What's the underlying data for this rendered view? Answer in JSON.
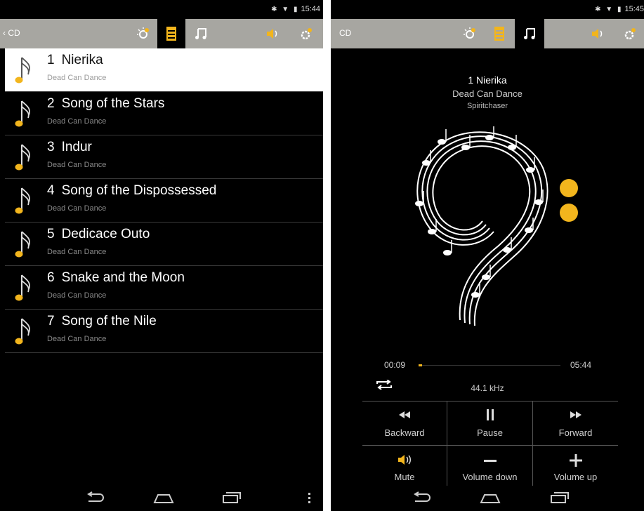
{
  "status": {
    "time_left": "15:44",
    "time_right": "15:45"
  },
  "left": {
    "back_label": "CD",
    "tracks": [
      {
        "num": "1",
        "title": "Nierika",
        "artist": "Dead Can Dance"
      },
      {
        "num": "2",
        "title": "Song of the Stars",
        "artist": "Dead Can Dance"
      },
      {
        "num": "3",
        "title": "Indur",
        "artist": "Dead Can Dance"
      },
      {
        "num": "4",
        "title": "Song of the Dispossessed",
        "artist": "Dead Can Dance"
      },
      {
        "num": "5",
        "title": "Dedicace Outo",
        "artist": "Dead Can Dance"
      },
      {
        "num": "6",
        "title": "Snake and the Moon",
        "artist": "Dead Can Dance"
      },
      {
        "num": "7",
        "title": "Song of the Nile",
        "artist": "Dead Can Dance"
      }
    ]
  },
  "right": {
    "source_label": "CD",
    "now_playing": {
      "title": "1  Nierika",
      "artist": "Dead Can Dance",
      "album": "Spiritchaser"
    },
    "elapsed": "00:09",
    "duration": "05:44",
    "progress_fraction": 0.026,
    "sample_rate": "44.1 kHz",
    "controls": {
      "backward": "Backward",
      "pause": "Pause",
      "forward": "Forward",
      "mute": "Mute",
      "volume_down": "Volume down",
      "volume_up": "Volume up"
    }
  },
  "colors": {
    "accent": "#f2b51d",
    "toolbar": "#a7a6a1",
    "background": "#000000"
  },
  "icons": {
    "toolbar": [
      "settings-sun-icon",
      "list-icon",
      "music-note-icon",
      "speaker-icon",
      "gear-icon"
    ],
    "track": "music-note-icon",
    "nav": [
      "back-icon",
      "home-icon",
      "recents-icon",
      "menu-icon"
    ]
  }
}
